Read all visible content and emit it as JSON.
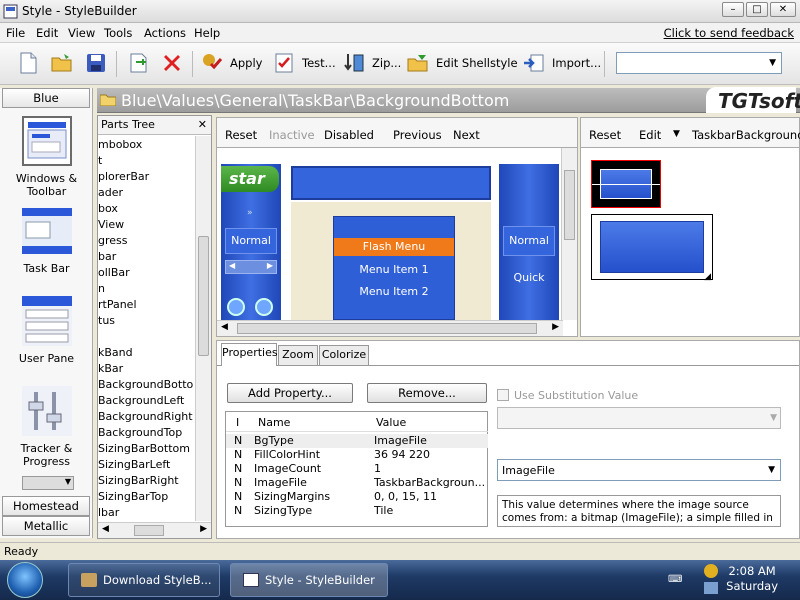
{
  "window": {
    "title": "Style - StyleBuilder"
  },
  "menu": {
    "items": [
      "File",
      "Edit",
      "View",
      "Tools",
      "Actions",
      "Help"
    ],
    "feedback": "Click to send feedback"
  },
  "toolbar": {
    "apply": "Apply",
    "test": "Test...",
    "zip": "Zip...",
    "edit_shellstyle": "Edit Shellstyle",
    "import": "Import...",
    "combo_value": ""
  },
  "left_strip": {
    "top_group": "Blue",
    "items": [
      {
        "label": "Windows &\nToolbar",
        "icon": "windows-toolbar-thumb"
      },
      {
        "label": "Task Bar",
        "icon": "taskbar-thumb"
      },
      {
        "label": "User Pane",
        "icon": "userpane-thumb"
      },
      {
        "label": "Tracker &\nProgress",
        "icon": "tracker-thumb"
      }
    ],
    "bottom_groups": [
      "Homestead",
      "Metallic"
    ]
  },
  "path": {
    "text": "Blue\\Values\\General\\TaskBar\\BackgroundBottom",
    "logo": "TGTsoft"
  },
  "parts_tree": {
    "title": "Parts Tree",
    "items": [
      "mbobox",
      "t",
      "plorerBar",
      "ader",
      "box",
      "View",
      "gress",
      "bar",
      "ollBar",
      "n",
      "rtPanel",
      "tus",
      "",
      "kBand",
      "kBar",
      "BackgroundBottom",
      "BackgroundLeft",
      "BackgroundRight",
      "BackgroundTop",
      "SizingBarBottom",
      "SizingBarLeft",
      "SizingBarRight",
      "SizingBarTop",
      "lbar"
    ]
  },
  "preview_toolbar": {
    "reset": "Reset",
    "inactive": "Inactive",
    "disabled": "Disabled",
    "previous": "Previous",
    "next": "Next"
  },
  "preview": {
    "start": "star",
    "normal_left": "Normal",
    "flash_menu": "Flash Menu",
    "menu_item_1": "Menu Item 1",
    "menu_item_2": "Menu Item 2",
    "normal_right": "Normal",
    "quick": "Quick"
  },
  "image_toolbar": {
    "reset": "Reset",
    "edit": "Edit",
    "name": "TaskbarBackground."
  },
  "tabs": [
    "Properties",
    "Zoom",
    "Colorize"
  ],
  "property_buttons": {
    "add": "Add Property...",
    "remove": "Remove..."
  },
  "property_list": {
    "headers": [
      "I",
      "Name",
      "Value"
    ],
    "rows": [
      {
        "i": "N",
        "name": "BgType",
        "value": "ImageFile"
      },
      {
        "i": "N",
        "name": "FillColorHint",
        "value": "36 94 220"
      },
      {
        "i": "N",
        "name": "ImageCount",
        "value": "1"
      },
      {
        "i": "N",
        "name": "ImageFile",
        "value": "TaskbarBackgroun..."
      },
      {
        "i": "N",
        "name": "SizingMargins",
        "value": "0, 0, 15, 11"
      },
      {
        "i": "N",
        "name": "SizingType",
        "value": "Tile"
      }
    ]
  },
  "substitution": {
    "label": "Use Substitution Value",
    "value_combo": "",
    "type_combo": "ImageFile"
  },
  "description": "This value determines where the image source comes from: a bitmap (ImageFile);  a simple filled in rectangle with",
  "status": "Ready",
  "taskbar": {
    "tasks": [
      "Download StyleB...",
      "Style - StyleBuilder"
    ],
    "time": "2:08 AM",
    "day": "Saturday"
  },
  "colors": {
    "blue": "#2b57d9",
    "menu_orange": "#f07a1a",
    "start_green": "#3d8a2e"
  }
}
